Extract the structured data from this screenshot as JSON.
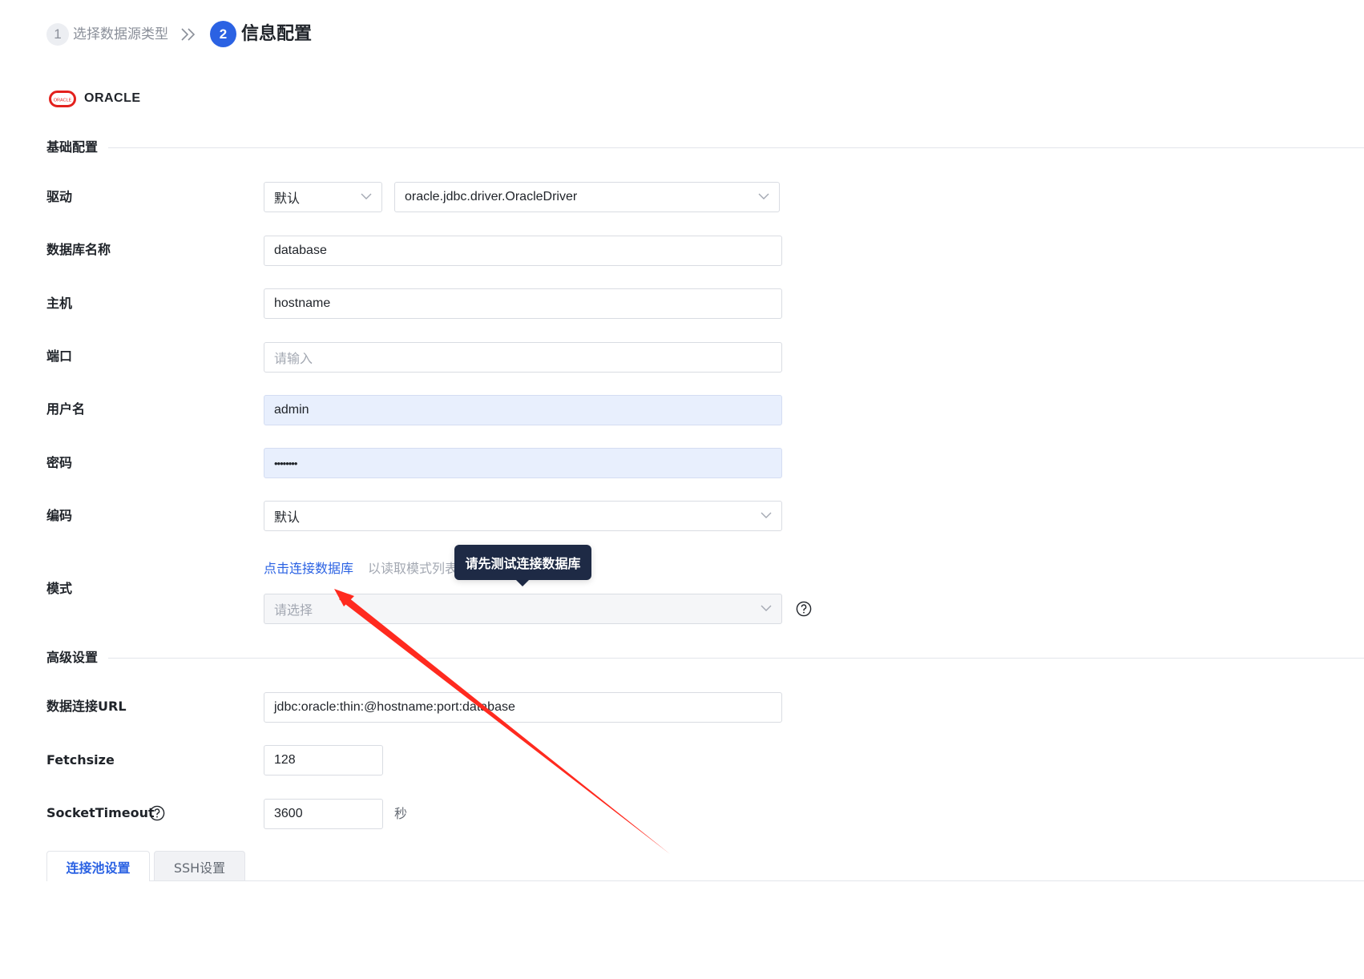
{
  "steps": [
    {
      "number": "1",
      "label": "选择数据源类型"
    },
    {
      "number": "2",
      "label": "信息配置"
    }
  ],
  "datasource": {
    "name": "ORACLE",
    "logo_icon": "oracle-logo-icon",
    "logo_text": "ORACLE"
  },
  "basic_section": {
    "title": "基础配置"
  },
  "driver": {
    "label": "驱动",
    "type_value": "默认",
    "class_value": "oracle.jdbc.driver.OracleDriver"
  },
  "database_name": {
    "label": "数据库名称",
    "value": "database"
  },
  "host": {
    "label": "主机",
    "value": "hostname"
  },
  "port": {
    "label": "端口",
    "placeholder": "请输入"
  },
  "username": {
    "label": "用户名",
    "value": "admin"
  },
  "password": {
    "label": "密码",
    "value": "••••••••"
  },
  "encoding": {
    "label": "编码",
    "value": "默认"
  },
  "schema": {
    "label": "模式",
    "connect_link": "点击连接数据库",
    "hint": "以读取模式列表",
    "placeholder": "请选择",
    "tooltip": "请先测试连接数据库"
  },
  "advanced_section": {
    "title": "高级设置"
  },
  "jdbc_url": {
    "label": "数据连接URL",
    "value": "jdbc:oracle:thin:@hostname:port:database"
  },
  "fetchsize": {
    "label": "Fetchsize",
    "value": "128"
  },
  "socket_timeout": {
    "label": "SocketTimeout",
    "value": "3600",
    "unit": "秒"
  },
  "tabs": [
    {
      "label": "连接池设置",
      "active": true
    },
    {
      "label": "SSH设置",
      "active": false
    }
  ],
  "colors": {
    "accent": "#2b62e3",
    "tooltip_bg": "#1e2a45",
    "annotation_arrow": "#ff2a1f",
    "oracle_red": "#e3211d"
  }
}
